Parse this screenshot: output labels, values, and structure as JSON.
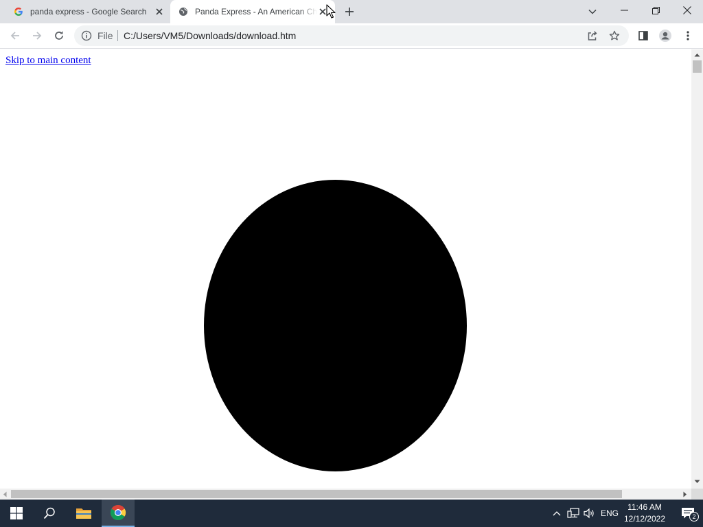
{
  "browser": {
    "tabs": [
      {
        "title": "panda express - Google Search",
        "favicon": "google-g-icon",
        "active": false
      },
      {
        "title": "Panda Express - An American Chi",
        "favicon": "globe-icon",
        "active": true
      }
    ],
    "address_bar": {
      "scheme_label": "File",
      "url": "C:/Users/VM5/Downloads/download.htm"
    }
  },
  "page": {
    "skip_link": "Skip to main content"
  },
  "taskbar": {
    "language": "ENG",
    "time": "11:46 AM",
    "date": "12/12/2022",
    "notification_count": "2"
  },
  "colors": {
    "tab_strip": "#dfe1e5",
    "link": "#0000ee",
    "disc": "#000000",
    "taskbar": "#1f2b3b"
  }
}
